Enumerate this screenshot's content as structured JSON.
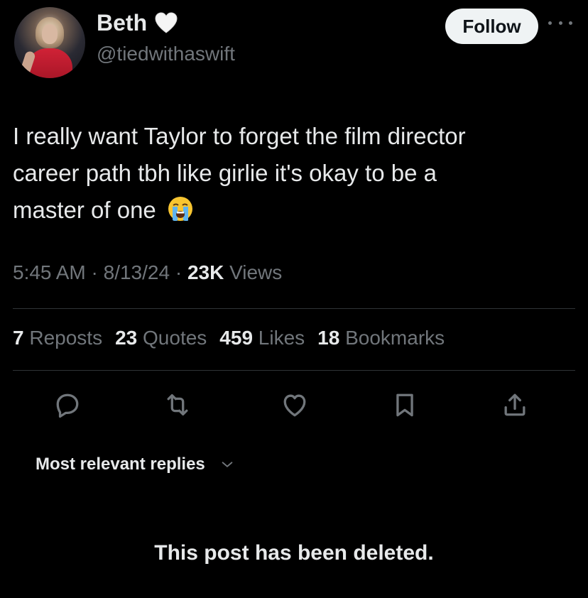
{
  "author": {
    "name": "Beth",
    "handle": "@tiedwithaswift",
    "verified_emoji": "white-heart"
  },
  "follow_label": "Follow",
  "tweet": {
    "lines": [
      "I really want Taylor to forget the film director",
      "career path tbh like girlie it's okay to be a",
      "master of one"
    ],
    "emoji": "loudly-crying-face"
  },
  "meta": {
    "time": "5:45 AM",
    "date": "8/13/24",
    "views_count": "23K",
    "views_label": "Views"
  },
  "stats": [
    {
      "count": "7",
      "label": "Reposts"
    },
    {
      "count": "23",
      "label": "Quotes"
    },
    {
      "count": "459",
      "label": "Likes"
    },
    {
      "count": "18",
      "label": "Bookmarks"
    }
  ],
  "actions": [
    "reply-icon",
    "repost-icon",
    "like-icon",
    "bookmark-icon",
    "share-icon"
  ],
  "replies_sort_label": "Most relevant replies",
  "deleted_notice": "This post has been deleted.",
  "colors": {
    "background": "#000000",
    "text_primary": "#e7e9ea",
    "text_secondary": "#71767b",
    "divider": "#2f3336",
    "follow_bg": "#eff3f4"
  }
}
